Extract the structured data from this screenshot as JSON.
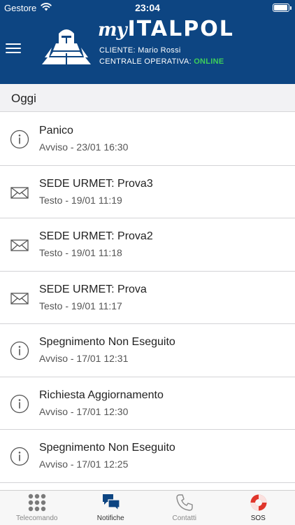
{
  "status_bar": {
    "carrier": "Gestore",
    "time": "23:04"
  },
  "header": {
    "brand_prefix": "my",
    "brand_name": "ITALPOL",
    "client_label": "CLIENTE:",
    "client_name": "Mario Rossi",
    "central_label": "CENTRALE OPERATIVA:",
    "central_status": "ONLINE",
    "colors": {
      "background": "#0d4582",
      "online": "#3ecf5a"
    }
  },
  "section": {
    "title": "Oggi"
  },
  "notifications": [
    {
      "icon": "info-icon",
      "title": "Panico",
      "subtitle": "Avviso - 23/01 16:30"
    },
    {
      "icon": "envelope-icon",
      "title": "SEDE URMET: Prova3",
      "subtitle": "Testo - 19/01 11:19"
    },
    {
      "icon": "envelope-icon",
      "title": "SEDE URMET: Prova2",
      "subtitle": "Testo - 19/01 11:18"
    },
    {
      "icon": "envelope-icon",
      "title": "SEDE URMET: Prova",
      "subtitle": "Testo - 19/01 11:17"
    },
    {
      "icon": "info-icon",
      "title": "Spegnimento Non Eseguito",
      "subtitle": "Avviso - 17/01 12:31"
    },
    {
      "icon": "info-icon",
      "title": "Richiesta Aggiornamento",
      "subtitle": "Avviso - 17/01 12:30"
    },
    {
      "icon": "info-icon",
      "title": "Spegnimento Non Eseguito",
      "subtitle": "Avviso - 17/01 12:25"
    }
  ],
  "tabs": [
    {
      "label": "Telecomando",
      "icon": "keypad-icon",
      "active": false
    },
    {
      "label": "Notifiche",
      "icon": "chat-bubbles-icon",
      "active": true
    },
    {
      "label": "Contatti",
      "icon": "phone-icon",
      "active": false
    },
    {
      "label": "SOS",
      "icon": "lifebuoy-icon",
      "active": false
    }
  ]
}
